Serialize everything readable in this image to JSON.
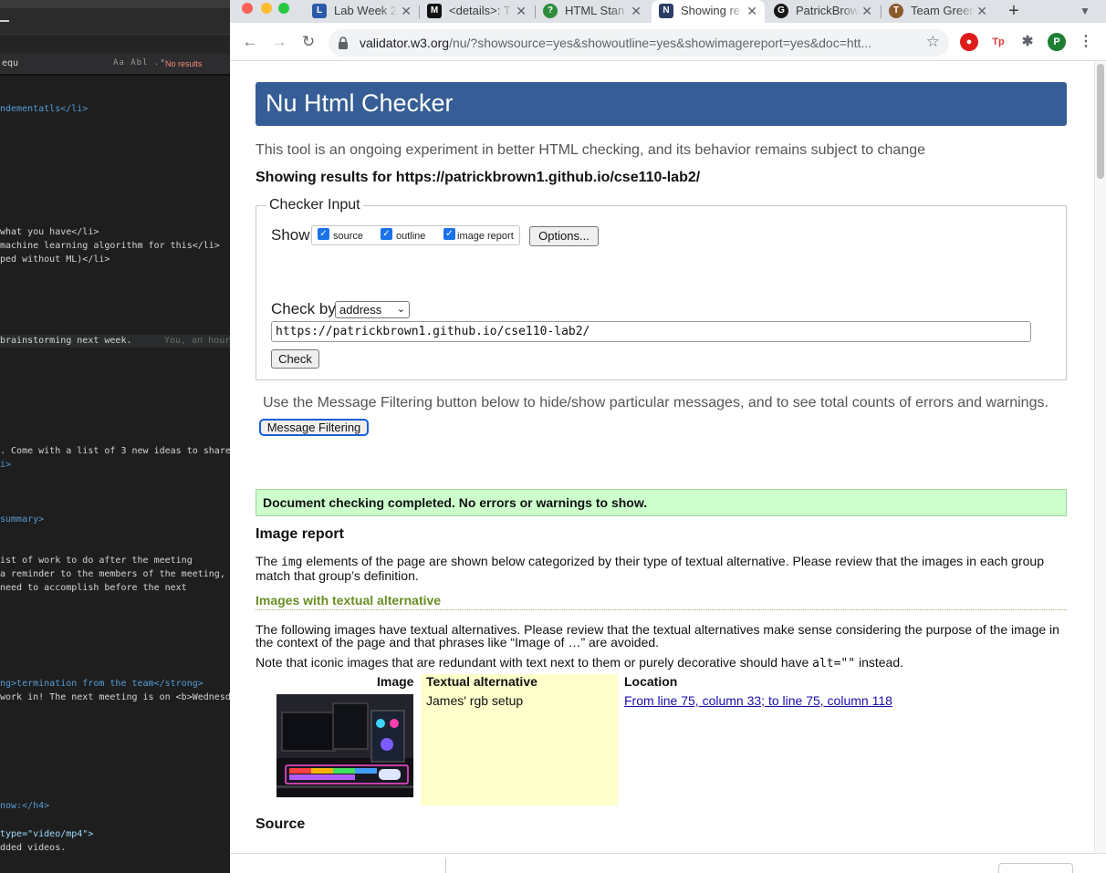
{
  "editor": {
    "find_term": "equ",
    "find_options": "Aa  Abl  .*",
    "find_status": "No results",
    "lines": [
      {
        "text": "ndementatls</li>"
      },
      {
        "text": "what you have</li>"
      },
      {
        "text": "machine learning algorithm for this</li>"
      },
      {
        "text": "ped without ML)</li>"
      },
      {
        "text": "brainstorming next week."
      },
      {
        "text": "You, an hour"
      },
      {
        "text": ". Come with a list of 3 new ideas to share"
      },
      {
        "text": "i>"
      },
      {
        "text": "summary>"
      },
      {
        "text": "ist of work to do after the meeting"
      },
      {
        "text": "a reminder to the members of the meeting,"
      },
      {
        "text": "need to accomplish before the next"
      },
      {
        "text": "ng>termination from the team</strong>"
      },
      {
        "text": "work in! The next meeting is on <b>Wednesd"
      },
      {
        "text": "now:</h4>"
      },
      {
        "text": "type=\"video/mp4\">"
      },
      {
        "text": "dded videos."
      }
    ]
  },
  "browser": {
    "tabs": [
      {
        "title": "Lab Week 2",
        "icon": "lab-favicon",
        "color": "#2b5ba8"
      },
      {
        "title": "<details>: T",
        "icon": "mdn-favicon",
        "color": "#111111"
      },
      {
        "title": "HTML Stan",
        "icon": "help-circle-favicon",
        "color": "#2e8b3a"
      },
      {
        "title": "Showing re",
        "icon": "nu-favicon",
        "color": "#2c3e66",
        "active": true
      },
      {
        "title": "PatrickBrow",
        "icon": "github-favicon",
        "color": "#181717"
      },
      {
        "title": "Team Green",
        "icon": "team-favicon",
        "color": "#8b5a2b"
      }
    ],
    "new_tab": "+",
    "url_host": "validator.w3.org",
    "url_rest": "/nu/?showsource=yes&showoutline=yes&showimagereport=yes&doc=htt...",
    "profile_initial": "P",
    "ext_labels": [
      "Tp"
    ]
  },
  "page": {
    "title": "Nu Html Checker",
    "intro": "This tool is an ongoing experiment in better HTML checking, and its behavior remains subject to change",
    "results_for": "Showing results for https://patrickbrown1.github.io/cse110-lab2/",
    "checker_input_legend": "Checker Input",
    "show_label": "Show",
    "show_options": [
      {
        "label": "source",
        "checked": true
      },
      {
        "label": "outline",
        "checked": true
      },
      {
        "label": "image report",
        "checked": true
      }
    ],
    "options_button": "Options...",
    "check_by_label": "Check by",
    "check_by_value": "address",
    "address_value": "https://patrickbrown1.github.io/cse110-lab2/",
    "check_button": "Check",
    "filter_text": "Use the Message Filtering button below to hide/show particular messages, and to see total counts of errors and warnings.",
    "filter_button": "Message Filtering",
    "success_message": "Document checking completed. No errors or warnings to show.",
    "image_report_heading": "Image report",
    "image_report_desc_pre": "The ",
    "image_report_desc_code": "img",
    "image_report_desc_post": " elements of the page are shown below categorized by their type of textual alternative. Please review that the images in each group match that group’s definition.",
    "textalt_heading": "Images with textual alternative",
    "textalt_desc": "The following images have textual alternatives. Please review that the textual alternatives make sense considering the purpose of the image in the context of the page and that phrases like “Image of …” are avoided.",
    "note_pre": "Note that iconic images that are redundant with text next to them or purely decorative should have ",
    "note_code": "alt=\"\"",
    "note_post": " instead.",
    "table_headers": {
      "image": "Image",
      "alt": "Textual alternative",
      "location": "Location"
    },
    "row": {
      "alt": "James' rgb setup",
      "location": "From line 75, column 33; to line 75, column 118"
    },
    "source_heading": "Source",
    "colors": {
      "header_bg": "#365d95",
      "success_bg": "#ccffcc",
      "alt_cell_bg": "#ffffcc",
      "subheading": "#6a8e22"
    }
  }
}
